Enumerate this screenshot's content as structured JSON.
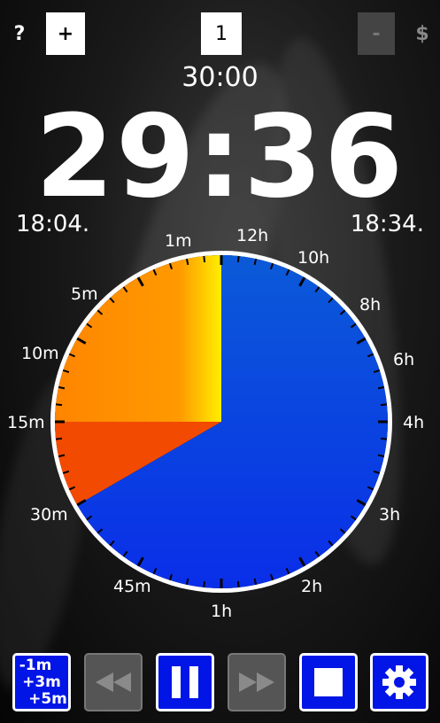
{
  "toolbar": {
    "help_label": "?",
    "add_label": "+",
    "counter_value": "1",
    "minus_label": "-",
    "shop_label": "$"
  },
  "timer": {
    "total": "30:00",
    "remaining": "29:36",
    "start_time": "18:04.",
    "end_time": "18:34."
  },
  "dial": {
    "labels_left": [
      "1m",
      "5m",
      "10m",
      "15m",
      "30m",
      "45m"
    ],
    "labels_right": [
      "12h",
      "10h",
      "8h",
      "6h",
      "4h",
      "3h",
      "2h",
      "1h"
    ],
    "colors": {
      "elapsed_yellow": "#ffea00",
      "elapsed_orange": "#ff8c00",
      "elapsed_red": "#f24a00",
      "remaining_blue": "#0a36e0",
      "face_outline": "#ffffff"
    }
  },
  "controls": {
    "adjust_lines": [
      "-1m",
      "+3m",
      "+5m"
    ],
    "rewind_icon": "rewind-icon",
    "pause_icon": "pause-icon",
    "forward_icon": "fast-forward-icon",
    "stop_icon": "stop-icon",
    "settings_icon": "gear-icon",
    "accent": "#0015e6"
  }
}
